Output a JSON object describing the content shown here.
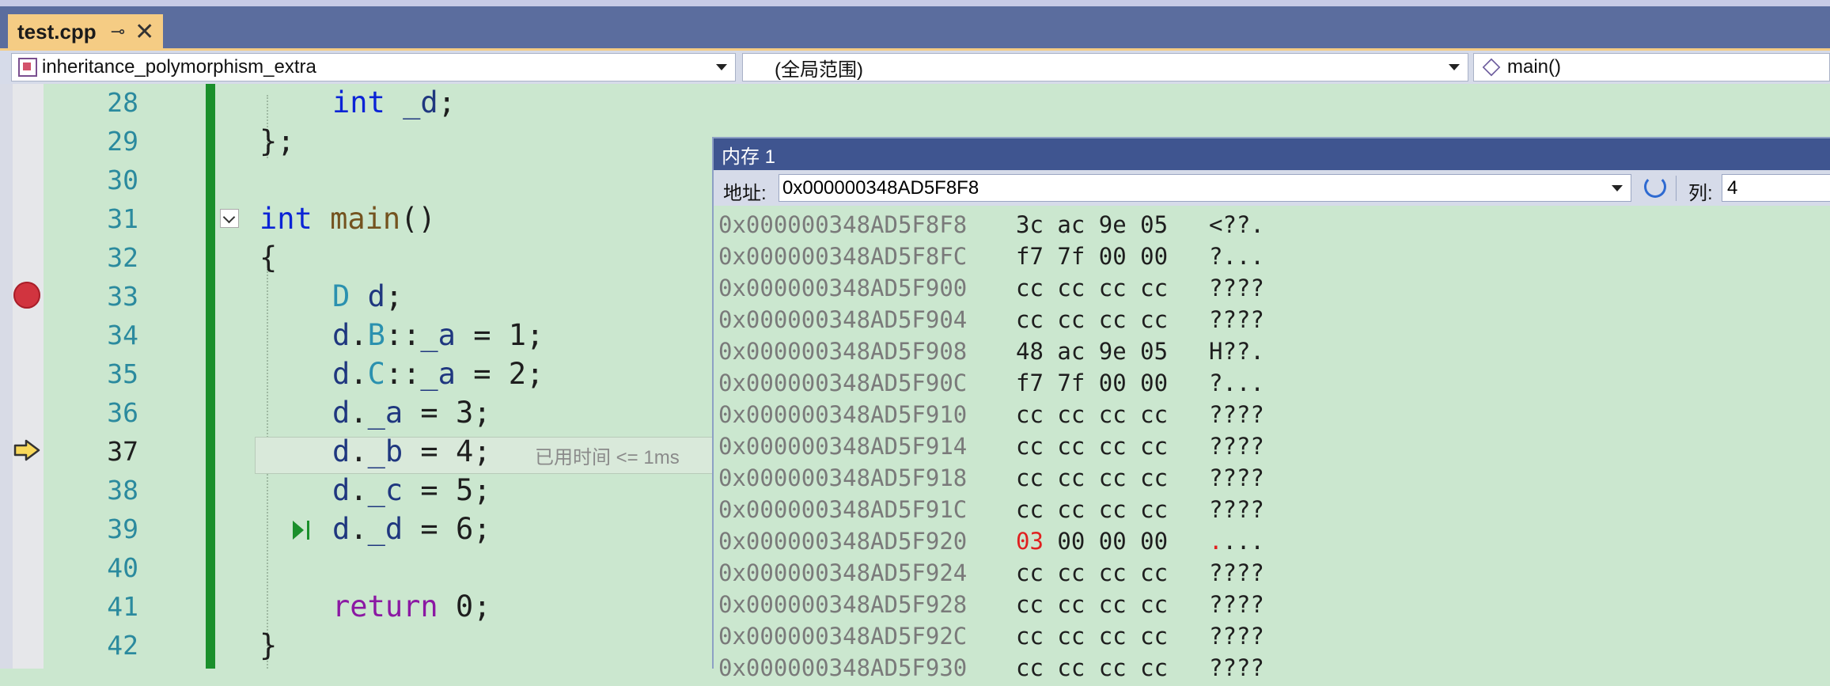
{
  "tab": {
    "title": "test.cpp",
    "pin": "⊸",
    "close": "✕"
  },
  "nav": {
    "project": "inheritance_polymorphism_extra",
    "scope": "(全局范围)",
    "member": "main()"
  },
  "editor": {
    "line_numbers": [
      "28",
      "29",
      "30",
      "31",
      "32",
      "33",
      "34",
      "35",
      "36",
      "37",
      "38",
      "39",
      "40",
      "41",
      "42"
    ],
    "perf_tip": "已用时间 <= 1ms"
  },
  "memory": {
    "title": "内存 1",
    "address_label": "地址:",
    "address_value": "0x000000348AD5F8F8",
    "columns_label": "列:",
    "columns_value": "4",
    "rows": [
      {
        "addr": "0x000000348AD5F8F8",
        "bytes": "3c ac 9e 05",
        "ascii": "<??."
      },
      {
        "addr": "0x000000348AD5F8FC",
        "bytes": "f7 7f 00 00",
        "ascii": "?..."
      },
      {
        "addr": "0x000000348AD5F900",
        "bytes": "cc cc cc cc",
        "ascii": "????"
      },
      {
        "addr": "0x000000348AD5F904",
        "bytes": "cc cc cc cc",
        "ascii": "????"
      },
      {
        "addr": "0x000000348AD5F908",
        "bytes": "48 ac 9e 05",
        "ascii": "H??."
      },
      {
        "addr": "0x000000348AD5F90C",
        "bytes": "f7 7f 00 00",
        "ascii": "?..."
      },
      {
        "addr": "0x000000348AD5F910",
        "bytes": "cc cc cc cc",
        "ascii": "????"
      },
      {
        "addr": "0x000000348AD5F914",
        "bytes": "cc cc cc cc",
        "ascii": "????"
      },
      {
        "addr": "0x000000348AD5F918",
        "bytes": "cc cc cc cc",
        "ascii": "????"
      },
      {
        "addr": "0x000000348AD5F91C",
        "bytes": "cc cc cc cc",
        "ascii": "????"
      },
      {
        "addr": "0x000000348AD5F920",
        "bytes": "03 00 00 00",
        "ascii": "....",
        "changed": true
      },
      {
        "addr": "0x000000348AD5F924",
        "bytes": "cc cc cc cc",
        "ascii": "????"
      },
      {
        "addr": "0x000000348AD5F928",
        "bytes": "cc cc cc cc",
        "ascii": "????"
      },
      {
        "addr": "0x000000348AD5F92C",
        "bytes": "cc cc cc cc",
        "ascii": "????"
      },
      {
        "addr": "0x000000348AD5F930",
        "bytes": "cc cc cc cc",
        "ascii": "????"
      }
    ]
  },
  "colors": {
    "editor_bg": "#cbe7cf",
    "tab_active": "#f5cc84",
    "title_bar": "#3f5590",
    "changed_byte": "#e02020",
    "breakpoint": "#d1343f"
  }
}
